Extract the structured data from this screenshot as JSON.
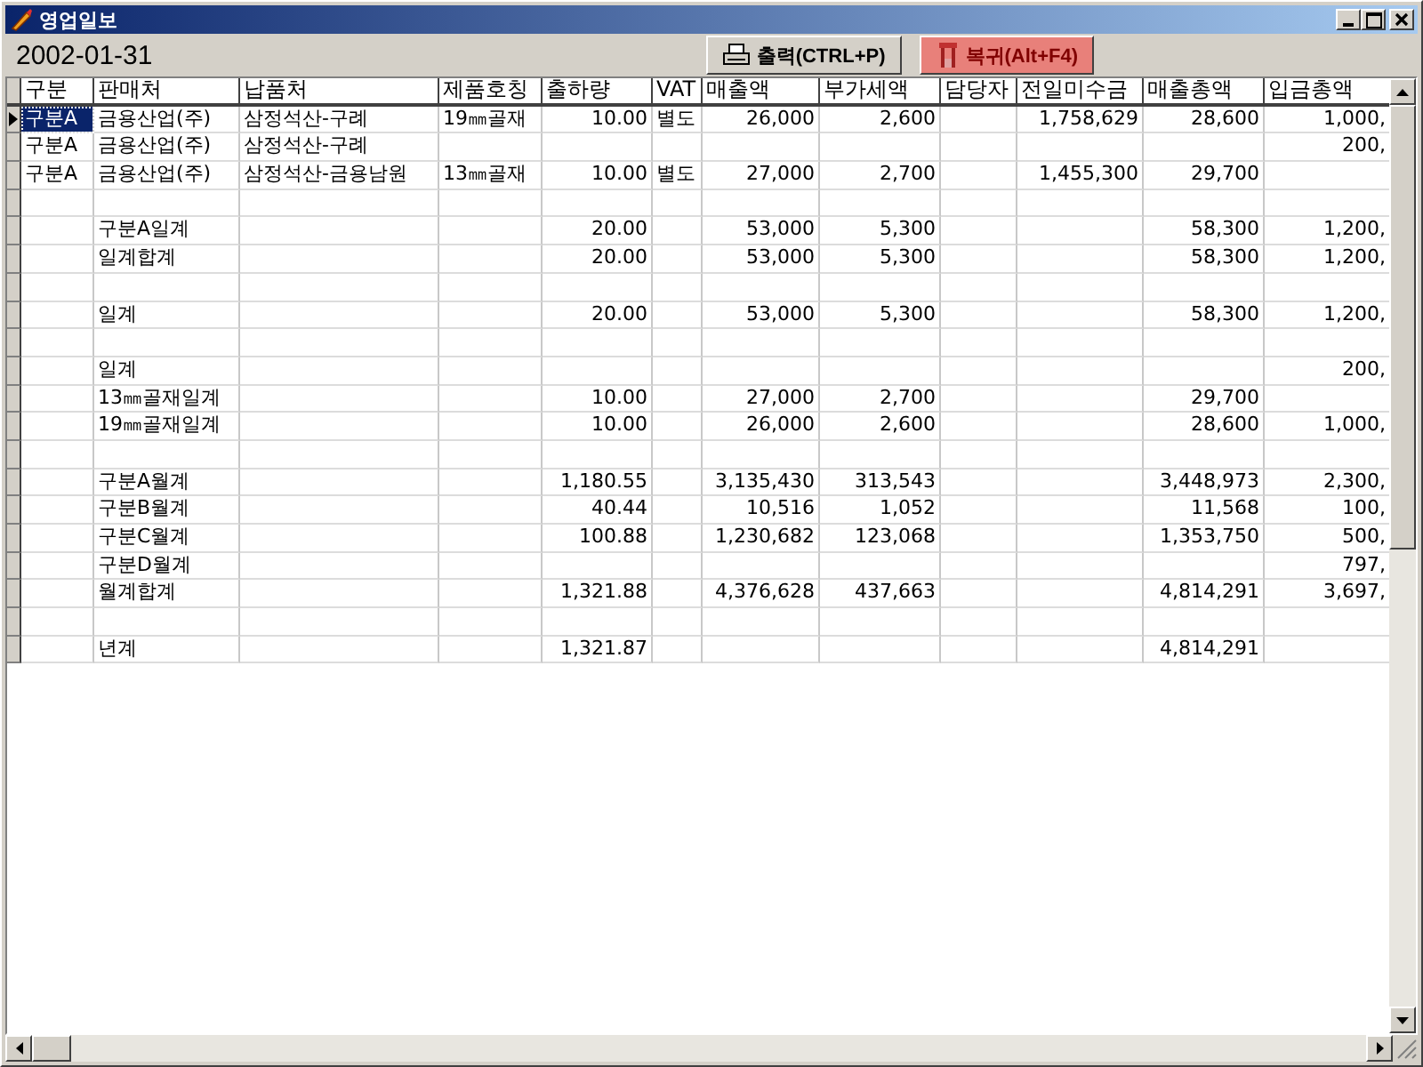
{
  "window": {
    "title": "영업일보"
  },
  "date": "2002-01-31",
  "buttons": [
    {
      "kind": "print",
      "label": "출력(CTRL+P)"
    },
    {
      "kind": "return",
      "label": "복귀(Alt+F4)"
    }
  ],
  "table": {
    "columns": [
      "구분",
      "판매처",
      "납품처",
      "제품호칭",
      "출하량",
      "VAT",
      "매출액",
      "부가세액",
      "담당자",
      "전일미수금",
      "매출총액",
      "입금총액"
    ],
    "rows": [
      {
        "current": true,
        "cells": [
          "구분A",
          "금용산업(주)",
          "삼정석산-구례",
          "19㎜골재",
          "10.00",
          "별도",
          "26,000",
          "2,600",
          null,
          "1,758,629",
          "28,600",
          "1,000,"
        ]
      },
      {
        "current": false,
        "cells": [
          "구분A",
          "금용산업(주)",
          "삼정석산-구례",
          null,
          null,
          null,
          null,
          null,
          null,
          null,
          null,
          "200,"
        ]
      },
      {
        "current": false,
        "cells": [
          "구분A",
          "금용산업(주)",
          "삼정석산-금용남원",
          "13㎜골재",
          "10.00",
          "별도",
          "27,000",
          "2,700",
          null,
          "1,455,300",
          "29,700",
          null
        ]
      },
      {
        "current": false,
        "cells": [
          null,
          null,
          null,
          null,
          null,
          null,
          null,
          null,
          null,
          null,
          null,
          null
        ]
      },
      {
        "current": false,
        "cells": [
          null,
          "구분A일계",
          null,
          null,
          "20.00",
          null,
          "53,000",
          "5,300",
          null,
          null,
          "58,300",
          "1,200,"
        ]
      },
      {
        "current": false,
        "cells": [
          null,
          "일계합계",
          null,
          null,
          "20.00",
          null,
          "53,000",
          "5,300",
          null,
          null,
          "58,300",
          "1,200,"
        ]
      },
      {
        "current": false,
        "cells": [
          null,
          null,
          null,
          null,
          null,
          null,
          null,
          null,
          null,
          null,
          null,
          null
        ]
      },
      {
        "current": false,
        "cells": [
          null,
          "일계",
          null,
          null,
          "20.00",
          null,
          "53,000",
          "5,300",
          null,
          null,
          "58,300",
          "1,200,"
        ]
      },
      {
        "current": false,
        "cells": [
          null,
          null,
          null,
          null,
          null,
          null,
          null,
          null,
          null,
          null,
          null,
          null
        ]
      },
      {
        "current": false,
        "cells": [
          null,
          "일계",
          null,
          null,
          null,
          null,
          null,
          null,
          null,
          null,
          null,
          "200,"
        ]
      },
      {
        "current": false,
        "cells": [
          null,
          "13㎜골재일계",
          null,
          null,
          "10.00",
          null,
          "27,000",
          "2,700",
          null,
          null,
          "29,700",
          null
        ]
      },
      {
        "current": false,
        "cells": [
          null,
          "19㎜골재일계",
          null,
          null,
          "10.00",
          null,
          "26,000",
          "2,600",
          null,
          null,
          "28,600",
          "1,000,"
        ]
      },
      {
        "current": false,
        "cells": [
          null,
          null,
          null,
          null,
          null,
          null,
          null,
          null,
          null,
          null,
          null,
          null
        ]
      },
      {
        "current": false,
        "cells": [
          null,
          "구분A월계",
          null,
          null,
          "1,180.55",
          null,
          "3,135,430",
          "313,543",
          null,
          null,
          "3,448,973",
          "2,300,"
        ]
      },
      {
        "current": false,
        "cells": [
          null,
          "구분B월계",
          null,
          null,
          "40.44",
          null,
          "10,516",
          "1,052",
          null,
          null,
          "11,568",
          "100,"
        ]
      },
      {
        "current": false,
        "cells": [
          null,
          "구분C월계",
          null,
          null,
          "100.88",
          null,
          "1,230,682",
          "123,068",
          null,
          null,
          "1,353,750",
          "500,"
        ]
      },
      {
        "current": false,
        "cells": [
          null,
          "구분D월계",
          null,
          null,
          null,
          null,
          null,
          null,
          null,
          null,
          null,
          "797,"
        ]
      },
      {
        "current": false,
        "cells": [
          null,
          "월계합계",
          null,
          null,
          "1,321.88",
          null,
          "4,376,628",
          "437,663",
          null,
          null,
          "4,814,291",
          "3,697,"
        ]
      },
      {
        "current": false,
        "cells": [
          null,
          null,
          null,
          null,
          null,
          null,
          null,
          null,
          null,
          null,
          null,
          null
        ]
      },
      {
        "current": false,
        "cells": [
          null,
          "년계",
          null,
          null,
          "1,321.87",
          null,
          null,
          null,
          null,
          null,
          "4,814,291",
          null
        ]
      }
    ]
  }
}
